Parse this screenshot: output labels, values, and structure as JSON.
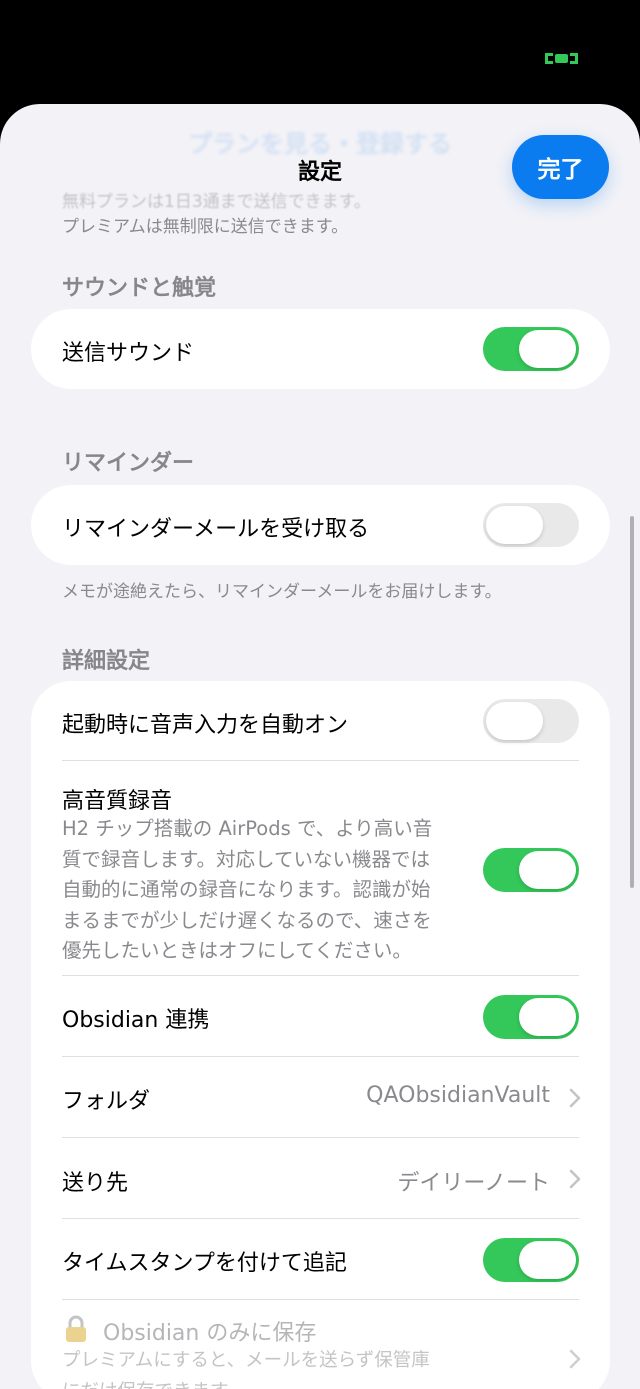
{
  "colors": {
    "accent": "#0a7cf0",
    "toggle_on": "#34c759",
    "toggle_off": "#e9e9ea",
    "background": "#f2f2f7"
  },
  "header": {
    "faded_title": "プランを見る・登録する",
    "title": "設定",
    "done_label": "完了"
  },
  "premium_note": {
    "line1": "無料プランは1日3通まで送信できます。",
    "line2": "プレミアムは無制限に送信できます。"
  },
  "sections": {
    "sound": {
      "header": "サウンドと触覚",
      "rows": [
        {
          "label": "送信サウンド",
          "toggle": true
        }
      ]
    },
    "reminder": {
      "header": "リマインダー",
      "rows": [
        {
          "label": "リマインダーメールを受け取る",
          "toggle": false
        }
      ],
      "footer": "メモが途絶えたら、リマインダーメールをお届けします。"
    },
    "advanced": {
      "header": "詳細設定",
      "rows": [
        {
          "label": "起動時に音声入力を自動オン",
          "toggle": false
        },
        {
          "label": "高音質録音",
          "desc_lines": [
            "H2 チップ搭載の AirPods で、より高い音",
            "質で録音します。対応していない機器では",
            "自動的に通常の録音になります。認識が始",
            "まるまでが少しだけ遅くなるので、速さを",
            "優先したいときはオフにしてください。"
          ],
          "toggle": true
        },
        {
          "label": "Obsidian 連携",
          "toggle": true
        },
        {
          "label": "フォルダ",
          "value": "QAObsidianVault"
        },
        {
          "label": "送り先",
          "value": "デイリーノート"
        },
        {
          "label": "タイムスタンプを付けて追記",
          "toggle": true
        },
        {
          "label": "Obsidian のみに保存",
          "icon": "lock-icon",
          "desc_lines": [
            "プレミアムにすると、メールを送らず保管庫",
            "にだけ保存できます。"
          ]
        }
      ]
    }
  }
}
